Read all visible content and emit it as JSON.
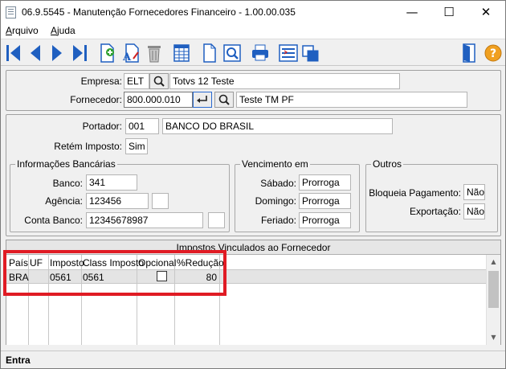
{
  "window": {
    "title": "06.9.5545 - Manutenção Fornecedores Financeiro - 1.00.00.035",
    "minimize_glyph": "—",
    "maximize_glyph": "☐",
    "close_glyph": "✕"
  },
  "menu": {
    "items": [
      {
        "label": "Arquivo",
        "accel": "A",
        "rest": "rquivo"
      },
      {
        "label": "Ajuda",
        "accel": "A",
        "rest": "juda"
      }
    ]
  },
  "toolbar": {
    "icons": [
      "first-record-icon",
      "previous-record-icon",
      "next-record-icon",
      "last-record-icon",
      "insert-record-icon",
      "edit-record-icon",
      "delete-trash-icon",
      "grid-view-icon",
      "new-document-icon",
      "preview-screen-icon",
      "print-icon",
      "export-list-icon",
      "copy-windows-icon",
      "exit-door-icon",
      "help-icon"
    ]
  },
  "header": {
    "empresa_label": "Empresa:",
    "empresa_code": "ELT",
    "empresa_name": "Totvs 12 Teste",
    "fornecedor_label": "Fornecedor:",
    "fornecedor_code": "800.000.010",
    "fornecedor_name": "Teste TM PF"
  },
  "portador": {
    "label": "Portador:",
    "code": "001",
    "name": "BANCO DO BRASIL"
  },
  "retem": {
    "label": "Retém Imposto:",
    "value": "Sim"
  },
  "bancarias": {
    "title": "Informações Bancárias",
    "banco_label": "Banco:",
    "banco_value": "341",
    "agencia_label": "Agência:",
    "agencia_value": "123456",
    "agencia_dv": "",
    "conta_label": "Conta Banco:",
    "conta_value": "12345678987",
    "conta_dv": ""
  },
  "vencimento": {
    "title": "Vencimento em",
    "sabado_label": "Sábado:",
    "sabado_value": "Prorroga",
    "domingo_label": "Domingo:",
    "domingo_value": "Prorroga",
    "feriado_label": "Feriado:",
    "feriado_value": "Prorroga"
  },
  "outros": {
    "title": "Outros",
    "bloqueia_label": "Bloqueia Pagamento:",
    "bloqueia_value": "Não",
    "exportacao_label": "Exportação:",
    "exportacao_value": "Não"
  },
  "impostos": {
    "caption": "Impostos Vinculados ao Fornecedor",
    "columns": [
      "País",
      "UF",
      "Imposto",
      "Class Imposto",
      "Opcional",
      "%Redução"
    ],
    "rows": [
      {
        "pais": "BRA",
        "uf": "",
        "imposto": "0561",
        "class_imposto": "0561",
        "opcional": false,
        "reducao": "80"
      }
    ]
  },
  "status": {
    "text": "Entra"
  },
  "colors": {
    "highlight": "#e01b24",
    "toolbar_blue": "#1f5fc0",
    "help_orange": "#f0a020"
  }
}
